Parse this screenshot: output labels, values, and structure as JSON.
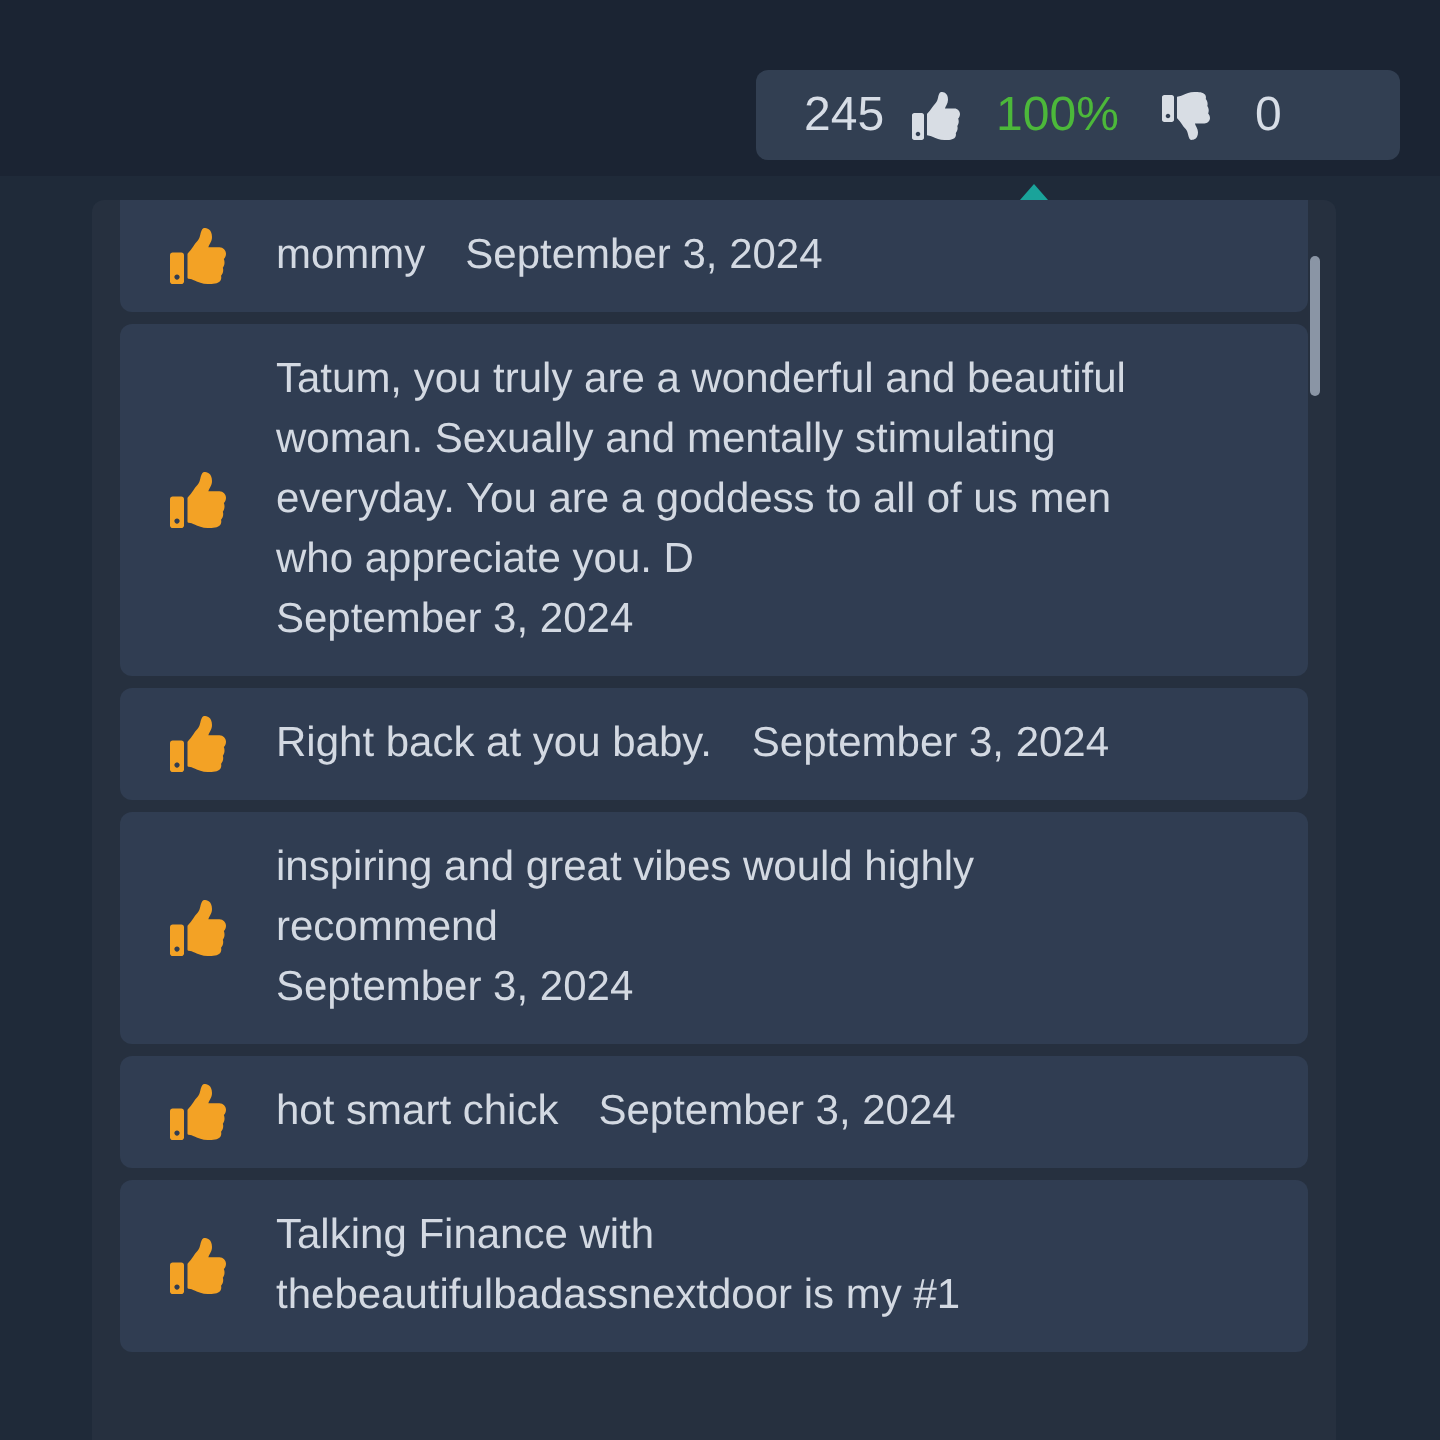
{
  "rating": {
    "likes": "245",
    "percent": "100%",
    "dislikes": "0"
  },
  "reviews": [
    {
      "text": "mommy",
      "date": "September 3, 2024"
    },
    {
      "text": "Tatum, you truly are a wonderful and beautiful woman. Sexually and mentally stimulating everyday. You are a goddess to all of us men who appreciate you. D",
      "date": "September 3, 2024"
    },
    {
      "text": "Right back at you baby.",
      "date": "September 3, 2024"
    },
    {
      "text": "inspiring and great vibes would highly recommend",
      "date": "September 3, 2024"
    },
    {
      "text": "hot smart chick",
      "date": "September 3, 2024"
    },
    {
      "text": "Talking Finance with thebeautifulbadassnextdoor is my #1"
    }
  ]
}
